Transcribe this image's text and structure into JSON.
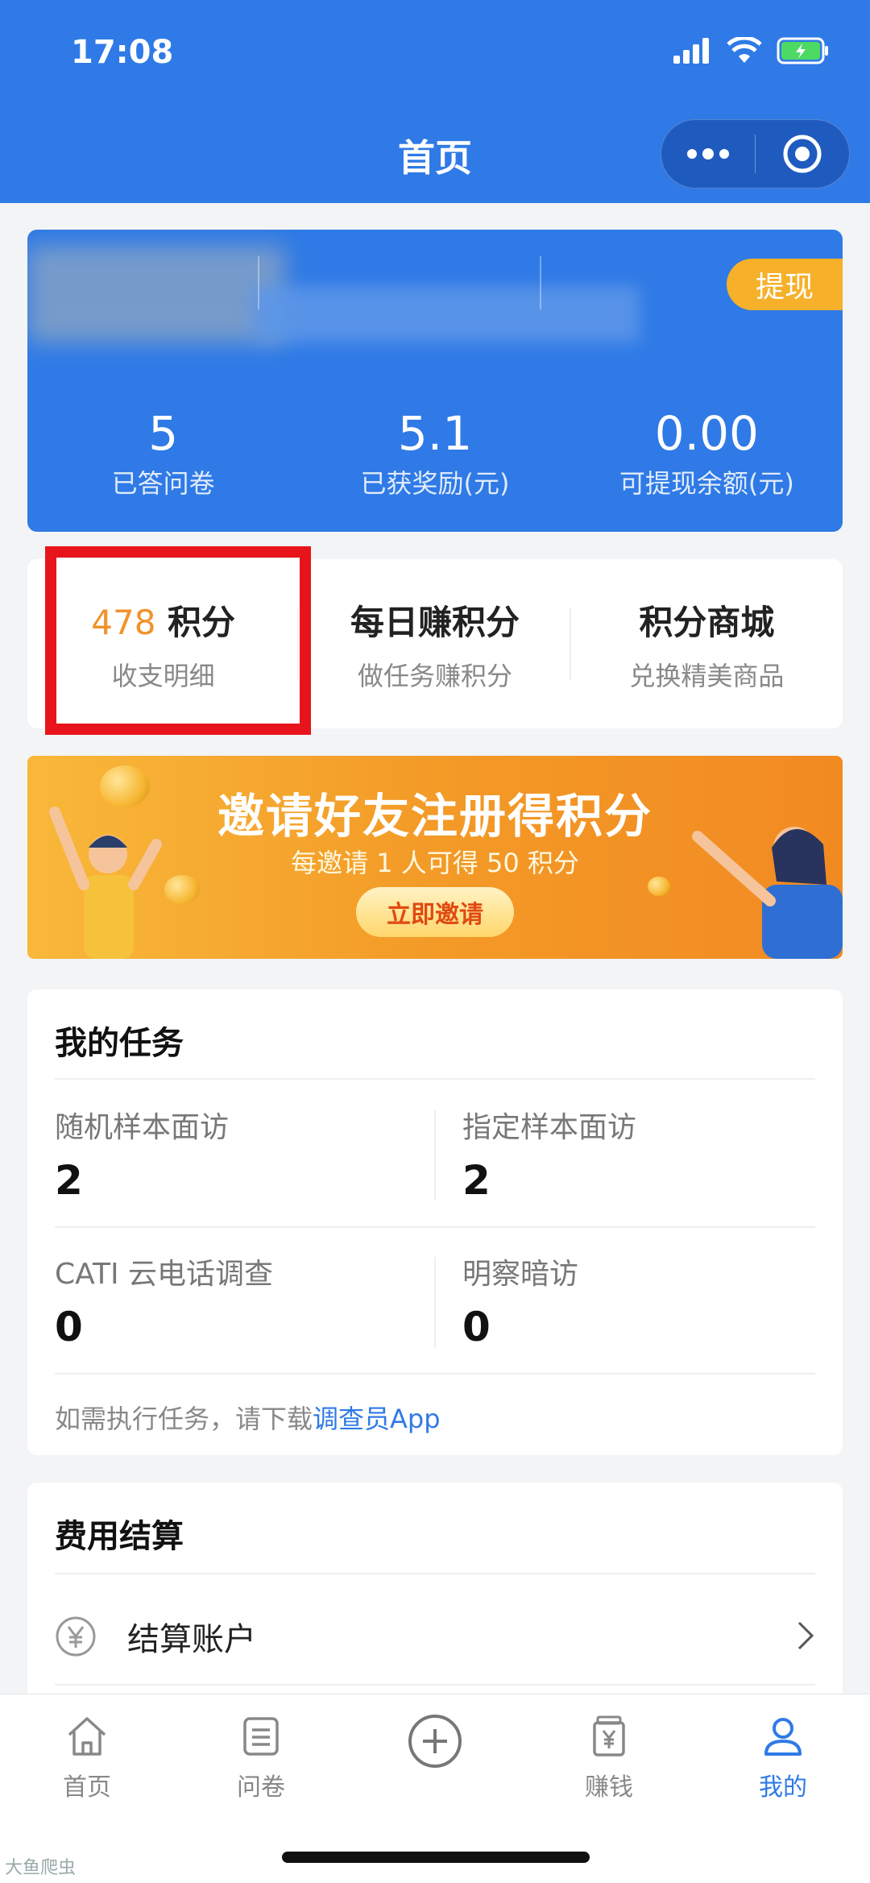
{
  "status": {
    "time": "17:08"
  },
  "nav": {
    "title": "首页"
  },
  "profile": {
    "withdraw_label": "提现",
    "stats": [
      {
        "value": "5",
        "label": "已答问卷"
      },
      {
        "value": "5.1",
        "label": "已获奖励(元)"
      },
      {
        "value": "0.00",
        "label": "可提现余额(元)"
      }
    ]
  },
  "points": {
    "balance_value": "478",
    "balance_unit": "积分",
    "balance_sub": "收支明细",
    "daily_title": "每日赚积分",
    "daily_sub": "做任务赚积分",
    "mall_title": "积分商城",
    "mall_sub": "兑换精美商品"
  },
  "banner": {
    "title": "邀请好友注册得积分",
    "subtitle": "每邀请 1 人可得 50 积分",
    "button": "立即邀请"
  },
  "tasks": {
    "title": "我的任务",
    "items": [
      {
        "label": "随机样本面访",
        "value": "2"
      },
      {
        "label": "指定样本面访",
        "value": "2"
      },
      {
        "label": "CATI 云电话调查",
        "value": "0"
      },
      {
        "label": "明察暗访",
        "value": "0"
      }
    ],
    "note_prefix": "如需执行任务，请下载",
    "note_link": "调查员App"
  },
  "fees": {
    "title": "费用结算",
    "account_label": "结算账户"
  },
  "tabbar": {
    "items": [
      {
        "label": "首页",
        "icon": "home-icon"
      },
      {
        "label": "问卷",
        "icon": "survey-icon"
      },
      {
        "label": "",
        "icon": "plus-circle-icon"
      },
      {
        "label": "赚钱",
        "icon": "earn-icon"
      },
      {
        "label": "我的",
        "icon": "user-icon"
      }
    ]
  },
  "watermark": "大鱼爬虫",
  "colors": {
    "primary": "#2f7ae6",
    "accent": "#f6b02a",
    "highlight": "#e8141b",
    "points_orange": "#f0922a"
  }
}
